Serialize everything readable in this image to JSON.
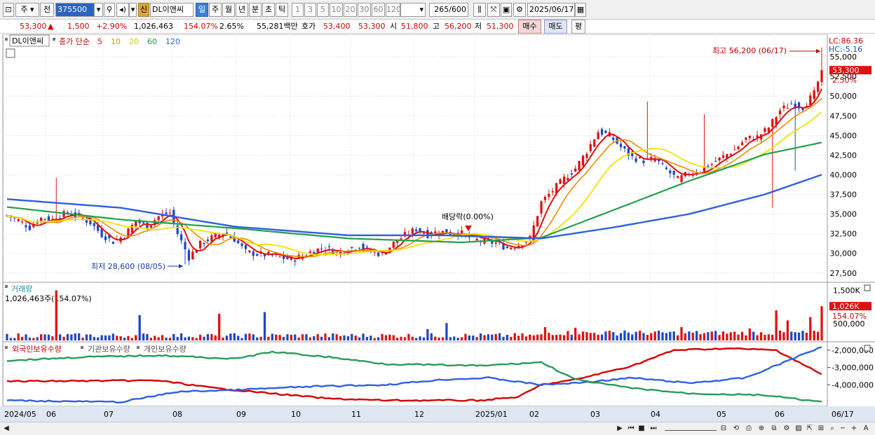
{
  "toolbar": {
    "stock_type": "주",
    "prev_label": "전",
    "stock_code": "375500",
    "stock_kind_badge": "신",
    "stock_name": "DL이앤씨",
    "periods": [
      "일",
      "주",
      "월",
      "년",
      "분",
      "초",
      "틱"
    ],
    "active_period": "일",
    "intervals": [
      "1",
      "3",
      "5",
      "10",
      "20",
      "30",
      "60",
      "120"
    ],
    "count_value": "265",
    "count_total": "/600",
    "date": "2025/06/17"
  },
  "quote": {
    "price": "53,300",
    "change_arrow": "▲",
    "change": "1,500",
    "change_pct": "+2.90%",
    "volume": "1,026,463",
    "volume_ratio": "154.07%",
    "turnover": "2.65%",
    "amount": "55,281백만",
    "bid_label": "호가",
    "bid_ask": "53,400",
    "bid_bid": "53,300",
    "open_label": "시",
    "open": "51,800",
    "high_label": "고",
    "high": "56,200",
    "low_label": "저",
    "low": "51,300",
    "buy_label": "매수",
    "sell_label": "매도",
    "eval_label": "평"
  },
  "legend": {
    "stock_name": "DL이앤씨",
    "price_label": "종가 단순",
    "ma": [
      {
        "period": "5",
        "color": "#e01010"
      },
      {
        "period": "10",
        "color": "#f28c00"
      },
      {
        "period": "20",
        "color": "#f2e200"
      },
      {
        "period": "60",
        "color": "#22a04a"
      },
      {
        "period": "120",
        "color": "#2f5fe0"
      }
    ],
    "lc_label": "LC:86.36",
    "hc_label": "HC:-5.16"
  },
  "annotations": {
    "high": "최고 56,200 (06/17)",
    "low": "최저 28,600 (08/05)",
    "dividend": "배당락(0.00%)"
  },
  "price_tags": {
    "current": "53,300",
    "pct": "2.30%"
  },
  "volume_panel": {
    "title": "거래량",
    "summary": "1,026,463주(154.07%)",
    "current_tag": "1,026K",
    "pct": "154.07%"
  },
  "holdings_panel": {
    "labels": [
      "외국인보유수량",
      "기관보유수량",
      "개인보유수량"
    ]
  },
  "colors": {
    "up": "#e01010",
    "down": "#1f46c7",
    "foreign": "#d40000",
    "institution": "#3060e0",
    "individual": "#2a9a5a"
  },
  "chart_data": [
    {
      "type": "line",
      "title": "DL이앤씨 일봉",
      "yaxis_ticks": [
        27500,
        30000,
        32500,
        35000,
        37500,
        40000,
        42500,
        45000,
        47500,
        50000,
        52500,
        55000
      ],
      "ylim": [
        26500,
        57500
      ],
      "x_labels": [
        "2024/05",
        "06",
        "07",
        "08",
        "09",
        "10",
        "11",
        "12",
        "2025/01",
        "02",
        "03",
        "04",
        "05",
        "06",
        "06/17"
      ],
      "series": [
        {
          "name": "종가",
          "points": [
            [
              0,
              34800
            ],
            [
              3,
              34200
            ],
            [
              6,
              33300
            ],
            [
              9,
              34500
            ],
            [
              12,
              34300
            ],
            [
              16,
              35200
            ],
            [
              19,
              34700
            ],
            [
              22,
              33900
            ],
            [
              25,
              32400
            ],
            [
              28,
              31500
            ],
            [
              31,
              32300
            ],
            [
              34,
              34100
            ],
            [
              37,
              33400
            ],
            [
              40,
              34700
            ],
            [
              43,
              35200
            ],
            [
              45,
              32500
            ],
            [
              48,
              29500
            ],
            [
              51,
              31200
            ],
            [
              54,
              32000
            ],
            [
              57,
              32600
            ],
            [
              60,
              31800
            ],
            [
              63,
              30200
            ],
            [
              66,
              29900
            ],
            [
              69,
              29800
            ],
            [
              72,
              29500
            ],
            [
              75,
              29200
            ],
            [
              78,
              29700
            ],
            [
              81,
              30400
            ],
            [
              84,
              30700
            ],
            [
              87,
              30100
            ],
            [
              90,
              30500
            ],
            [
              93,
              31000
            ],
            [
              96,
              30200
            ],
            [
              99,
              29900
            ],
            [
              102,
              31300
            ],
            [
              105,
              32300
            ],
            [
              108,
              33100
            ],
            [
              111,
              32400
            ],
            [
              114,
              32800
            ],
            [
              117,
              32600
            ],
            [
              120,
              32500
            ],
            [
              123,
              31800
            ],
            [
              126,
              31500
            ],
            [
              129,
              31300
            ],
            [
              132,
              30700
            ],
            [
              135,
              31100
            ],
            [
              138,
              31900
            ],
            [
              141,
              36500
            ],
            [
              144,
              38000
            ],
            [
              147,
              39500
            ],
            [
              150,
              40800
            ],
            [
              153,
              43000
            ],
            [
              156,
              45500
            ],
            [
              159,
              45000
            ],
            [
              162,
              43500
            ],
            [
              165,
              42200
            ],
            [
              168,
              41800
            ],
            [
              171,
              42000
            ],
            [
              174,
              40600
            ],
            [
              177,
              39400
            ],
            [
              180,
              40200
            ],
            [
              183,
              40500
            ],
            [
              186,
              41400
            ],
            [
              189,
              42300
            ],
            [
              192,
              43200
            ],
            [
              195,
              44600
            ],
            [
              198,
              44800
            ],
            [
              201,
              46000
            ],
            [
              204,
              48200
            ],
            [
              207,
              49000
            ],
            [
              210,
              48600
            ],
            [
              213,
              50300
            ],
            [
              215,
              53300
            ]
          ]
        },
        {
          "name": "5",
          "values_note": "smoothed close"
        },
        {
          "name": "10"
        },
        {
          "name": "20"
        },
        {
          "name": "60",
          "points": [
            [
              0,
              35900
            ],
            [
              30,
              34300
            ],
            [
              60,
              33200
            ],
            [
              90,
              31900
            ],
            [
              120,
              31400
            ],
            [
              141,
              32000
            ],
            [
              160,
              35500
            ],
            [
              180,
              39200
            ],
            [
              200,
              42600
            ],
            [
              215,
              44100
            ]
          ]
        },
        {
          "name": "120",
          "points": [
            [
              0,
              36900
            ],
            [
              30,
              35800
            ],
            [
              60,
              33400
            ],
            [
              90,
              32300
            ],
            [
              115,
              32300
            ],
            [
              141,
              31900
            ],
            [
              160,
              33300
            ],
            [
              180,
              35000
            ],
            [
              200,
              37500
            ],
            [
              215,
              40000
            ]
          ]
        }
      ],
      "high": {
        "x": 215,
        "y": 56200,
        "label": "최고 56,200 (06/17)"
      },
      "low": {
        "x": 47,
        "y": 28600,
        "label": "최저 28,600 (08/05)"
      }
    },
    {
      "type": "bar",
      "title": "거래량",
      "yaxis_ticks": [
        "500,000",
        "1,000,000",
        "1,500,000"
      ],
      "ylim": [
        0,
        1700000
      ],
      "last_value": 1026463,
      "spikes": [
        [
          13,
          1500000
        ],
        [
          35,
          760000
        ],
        [
          56,
          800000
        ],
        [
          68,
          850000
        ],
        [
          111,
          340000
        ],
        [
          116,
          520000
        ],
        [
          142,
          400000
        ],
        [
          150,
          380000
        ],
        [
          163,
          300000
        ],
        [
          178,
          400000
        ],
        [
          196,
          360000
        ],
        [
          203,
          900000
        ],
        [
          206,
          600000
        ],
        [
          212,
          700000
        ],
        [
          215,
          1026463
        ]
      ]
    },
    {
      "type": "line",
      "title": "보유수량",
      "yaxis_ticks": [
        "-2,000,000",
        "-3,000,000",
        "-4,000,000"
      ],
      "ylim": [
        -5200000,
        -1600000
      ],
      "series": [
        {
          "name": "외국인보유수량",
          "points": [
            [
              0,
              -3800000
            ],
            [
              40,
              -3750000
            ],
            [
              55,
              -4200000
            ],
            [
              70,
              -4500000
            ],
            [
              85,
              -4800000
            ],
            [
              100,
              -4900000
            ],
            [
              125,
              -4900000
            ],
            [
              135,
              -4700000
            ],
            [
              141,
              -4000000
            ],
            [
              150,
              -3700000
            ],
            [
              165,
              -2900000
            ],
            [
              176,
              -2000000
            ],
            [
              190,
              -1900000
            ],
            [
              203,
              -2000000
            ],
            [
              215,
              -3400000
            ]
          ]
        },
        {
          "name": "기관보유수량",
          "points": [
            [
              0,
              -4900000
            ],
            [
              30,
              -5000000
            ],
            [
              45,
              -4400000
            ],
            [
              60,
              -4300000
            ],
            [
              80,
              -4100000
            ],
            [
              100,
              -4000000
            ],
            [
              115,
              -3700000
            ],
            [
              127,
              -3600000
            ],
            [
              141,
              -4000000
            ],
            [
              150,
              -3900000
            ],
            [
              165,
              -3600000
            ],
            [
              180,
              -3900000
            ],
            [
              195,
              -3600000
            ],
            [
              205,
              -2700000
            ],
            [
              215,
              -1800000
            ]
          ]
        },
        {
          "name": "개인보유수량",
          "points": [
            [
              0,
              -2600000
            ],
            [
              20,
              -2400000
            ],
            [
              40,
              -2300000
            ],
            [
              60,
              -2500000
            ],
            [
              70,
              -2100000
            ],
            [
              85,
              -2400000
            ],
            [
              100,
              -2800000
            ],
            [
              125,
              -2900000
            ],
            [
              141,
              -2700000
            ],
            [
              150,
              -3700000
            ],
            [
              165,
              -4200000
            ],
            [
              180,
              -4500000
            ],
            [
              200,
              -4600000
            ],
            [
              215,
              -5000000
            ]
          ]
        }
      ]
    }
  ]
}
